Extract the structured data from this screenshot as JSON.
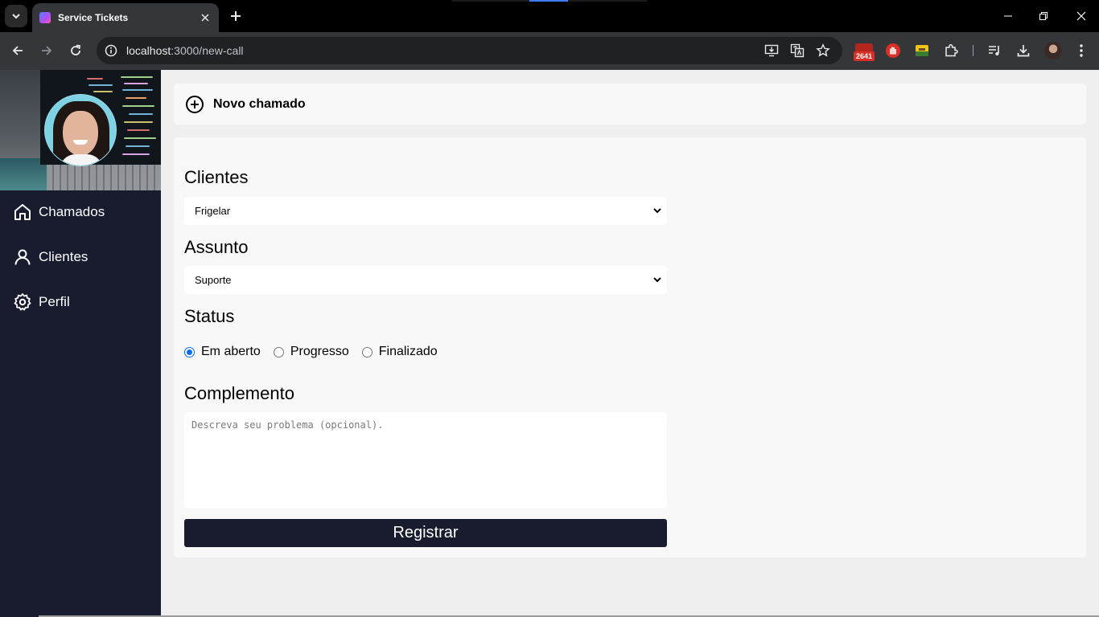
{
  "browser": {
    "tab_title": "Service Tickets",
    "url_host": "localhost",
    "url_path": ":3000/new-call",
    "extension_badge": "2641"
  },
  "sidebar": {
    "items": [
      {
        "label": "Chamados",
        "icon": "home-icon"
      },
      {
        "label": "Clientes",
        "icon": "user-icon"
      },
      {
        "label": "Perfil",
        "icon": "gear-icon"
      }
    ]
  },
  "header": {
    "title": "Novo chamado",
    "icon": "plus-circle-icon"
  },
  "form": {
    "clientes_label": "Clientes",
    "clientes_value": "Frigelar",
    "assunto_label": "Assunto",
    "assunto_value": "Suporte",
    "status_label": "Status",
    "status_options": [
      "Em aberto",
      "Progresso",
      "Finalizado"
    ],
    "status_selected": "Em aberto",
    "complemento_label": "Complemento",
    "complemento_placeholder": "Descreva seu problema (opcional).",
    "submit_label": "Registrar"
  },
  "colors": {
    "sidebar_bg": "#181c2e",
    "radio_accent": "#0b6ce6",
    "page_bg": "#efefef",
    "card_bg": "#f8f8f8"
  }
}
